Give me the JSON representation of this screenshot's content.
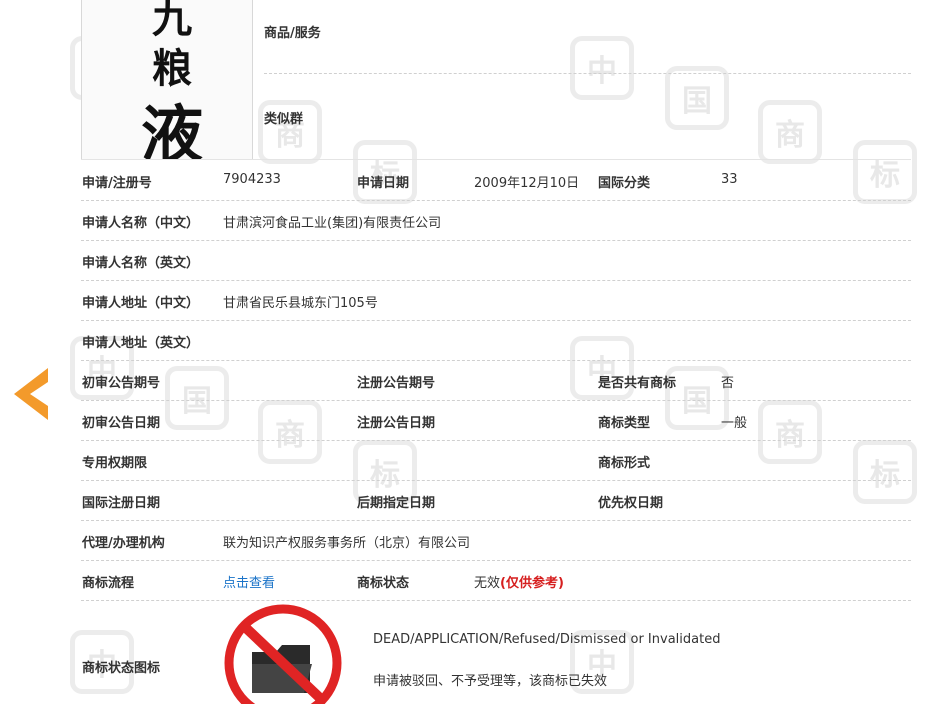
{
  "watermark": [
    "中",
    "国",
    "商",
    "标"
  ],
  "thumbnail": {
    "chars": [
      "九",
      "粮",
      "液"
    ]
  },
  "header_rows": {
    "goods_label": "商品/服务",
    "similar_group_label": "类似群"
  },
  "row1": {
    "reg_no_label": "申请/注册号",
    "reg_no": "7904233",
    "app_date_label": "申请日期",
    "app_date": "2009年12月10日",
    "intl_class_label": "国际分类",
    "intl_class": "33"
  },
  "applicant_cn_label": "申请人名称（中文）",
  "applicant_cn": "甘肃滨河食品工业(集团)有限责任公司",
  "applicant_en_label": "申请人名称（英文）",
  "address_cn_label": "申请人地址（中文）",
  "address_cn": "甘肃省民乐县城东门105号",
  "address_en_label": "申请人地址（英文）",
  "prelim_no_label": "初审公告期号",
  "reg_pub_no_label": "注册公告期号",
  "shared_label": "是否共有商标",
  "shared": "否",
  "prelim_date_label": "初审公告日期",
  "reg_pub_date_label": "注册公告日期",
  "tm_type_label": "商标类型",
  "tm_type": "一般",
  "exclusive_label": "专用权期限",
  "tm_form_label": "商标形式",
  "intl_reg_date_label": "国际注册日期",
  "later_date_label": "后期指定日期",
  "priority_label": "优先权日期",
  "agent_label": "代理/办理机构",
  "agent": "联为知识产权服务事务所（北京）有限公司",
  "flow_label": "商标流程",
  "flow_link": "点击查看",
  "status_label": "商标状态",
  "status": "无效",
  "status_note": "(仅供参考)",
  "status_icon_label": "商标状态图标",
  "status_en": "DEAD/APPLICATION/Refused/Dismissed or Invalidated",
  "status_cn": "申请被驳回、不予受理等，该商标已失效",
  "colors": {
    "accent_orange": "#f39a2b",
    "link_blue": "#1a73c8",
    "status_red": "#d61f1f",
    "dead_red": "#e02424"
  },
  "icons": [
    "prev-arrow-icon",
    "dead-folder-icon"
  ]
}
